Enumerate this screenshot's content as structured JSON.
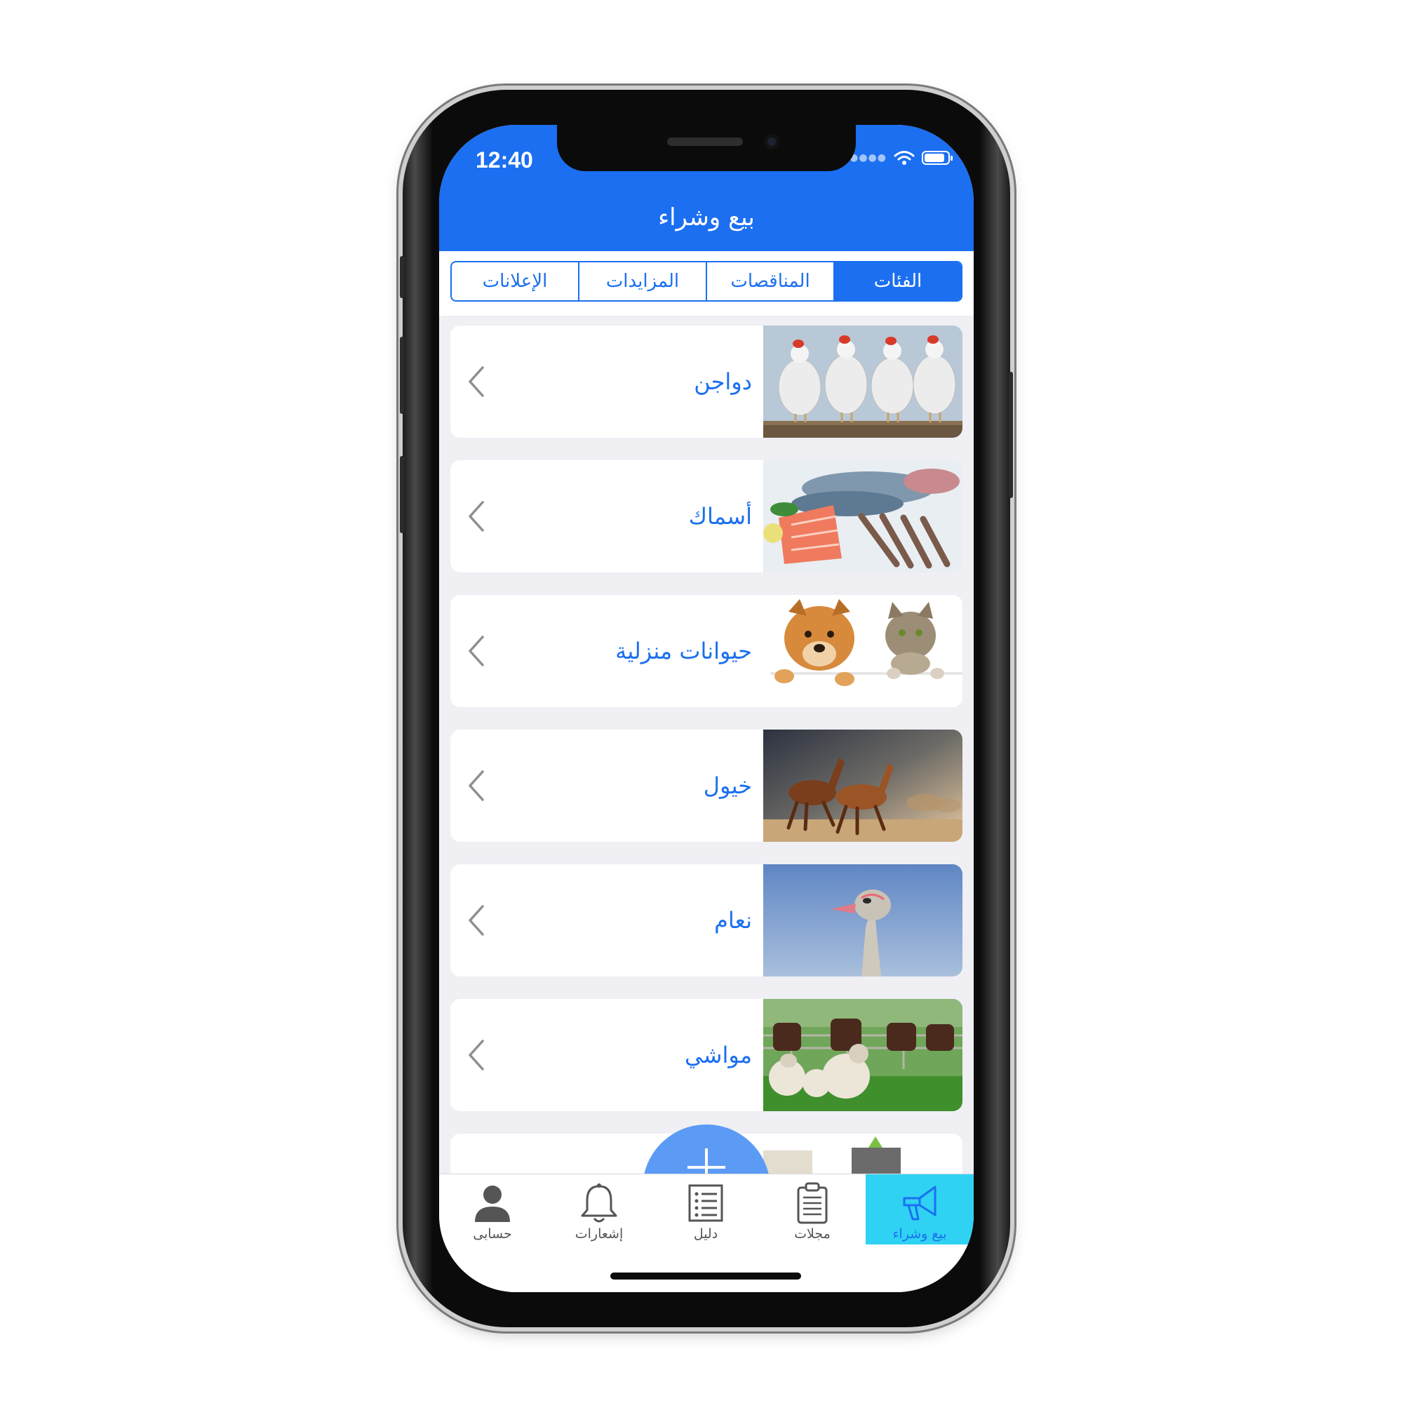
{
  "status_bar": {
    "time": "12:40"
  },
  "header": {
    "title": "بيع وشراء"
  },
  "segments": [
    {
      "label": "الإعلانات",
      "active": false
    },
    {
      "label": "المزايدات",
      "active": false
    },
    {
      "label": "المناقصات",
      "active": false
    },
    {
      "label": "الفئات",
      "active": true
    }
  ],
  "categories": [
    {
      "label": "دواجن",
      "image": "chickens"
    },
    {
      "label": "أسماك",
      "image": "fish-seafood"
    },
    {
      "label": "حيوانات منزلية",
      "image": "dog-and-cat"
    },
    {
      "label": "خيول",
      "image": "horses"
    },
    {
      "label": "نعام",
      "image": "ostrich"
    },
    {
      "label": "مواشي",
      "image": "sheep-and-cows"
    }
  ],
  "tabbar": {
    "items": [
      {
        "label": "حسابى",
        "icon": "person-icon"
      },
      {
        "label": "إشعارات",
        "icon": "bell-icon"
      },
      {
        "label": "دليل",
        "icon": "list-icon"
      },
      {
        "label": "مجلات",
        "icon": "clipboard-icon"
      },
      {
        "label": "بيع وشراء",
        "icon": "megaphone-icon",
        "active": true
      }
    ]
  },
  "colors": {
    "primary": "#1b6ff0",
    "active_tab": "#2fd2f2",
    "fab": "#5b9bf5",
    "list_bg": "#efeff4"
  }
}
